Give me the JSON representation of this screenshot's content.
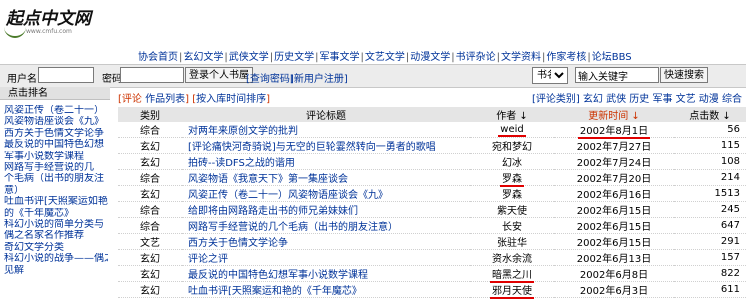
{
  "logo": {
    "text": "起点中文网",
    "url": "www.cmfu.com"
  },
  "nav": [
    "协会首页",
    "玄幻文学",
    "武侠文学",
    "历史文学",
    "军事文学",
    "文艺文学",
    "动漫文学",
    "书评杂论",
    "文学资料",
    "作家考核",
    "论坛BBS"
  ],
  "login": {
    "user_label": "用户名",
    "pass_label": "密码",
    "enter_button": "登录个人书屋",
    "query_pass": "[查询密码]",
    "register": "[新用户注册]",
    "search_select": "书名",
    "search_input": "输入关键字",
    "search_button": "快速搜索"
  },
  "sidebar": {
    "title": "点击排名",
    "items": [
      "风姿正传（卷二十一）",
      "风姿物语座谈会《九》",
      "西方关于色情文学论争",
      "最反说的中国特色幻想",
      "军事小说数学课程",
      "网路写手经营说的几",
      "个毛病（出书的朋友注",
      "意）",
      "吐血书评[天照案运如艳",
      "的《千年魔芯》",
      "科幻小说的简单分类与",
      "偶之名家名作推荐",
      "奇幻文学分类",
      "科幻小说的战争——偶之",
      "见解"
    ]
  },
  "main": {
    "review_label": "评论",
    "works_label": "作品列表",
    "sort_label": "按入库时间排序",
    "cat_links": "[评论类别] 玄幻 武侠 历史 军事 文艺 动漫 综合"
  },
  "table": {
    "headers": [
      "类别",
      "评论标题",
      "作者 ↓",
      "更新时间 ↓",
      "点击数 ↓"
    ],
    "rows": [
      {
        "cat": "综合",
        "title": "对两年来原创文学的批判",
        "author": "weid",
        "date": "2002年8月1日",
        "hits": "56",
        "mark_author": true,
        "mark_date": true
      },
      {
        "cat": "玄幻",
        "title": "[评论痛快河奇骑说]与无空的巨轮霎然转向一勇者的歌唱",
        "author": "宛和梦幻",
        "date": "2002年7月27日",
        "hits": "115"
      },
      {
        "cat": "玄幻",
        "title": "拍砖--读DFS之战的谐用",
        "author": "幻冰",
        "date": "2002年7月24日",
        "hits": "108"
      },
      {
        "cat": "综合",
        "title": "风姿物语《我意天下》第一集座谈会",
        "author": "罗森",
        "date": "2002年7月20日",
        "hits": "214",
        "mark_author": true
      },
      {
        "cat": "玄幻",
        "title": "风姿正传（卷二十一）风姿物语座谈会《九》",
        "author": "罗森",
        "date": "2002年6月16日",
        "hits": "1513"
      },
      {
        "cat": "综合",
        "title": "给即将由网路路走出书的师兄弟妹妹们",
        "author": "紫天使",
        "date": "2002年6月15日",
        "hits": "245"
      },
      {
        "cat": "综合",
        "title": "网路写手经营说的几个毛病（出书的朋友注意）",
        "author": "长安",
        "date": "2002年6月15日",
        "hits": "647"
      },
      {
        "cat": "文艺",
        "title": "西方关于色情文学论争",
        "author": "张驻华",
        "date": "2002年6月15日",
        "hits": "291"
      },
      {
        "cat": "玄幻",
        "title": "评论之评",
        "author": "资水余流",
        "date": "2002年6月13日",
        "hits": "157"
      },
      {
        "cat": "玄幻",
        "title": "最反说的中国特色幻想军事小说数学课程",
        "author": "暗黑之川",
        "date": "2002年6月8日",
        "hits": "822",
        "mark_author": true
      },
      {
        "cat": "玄幻",
        "title": "吐血书评[天照案运和艳的《千年魔芯》",
        "author": "邪月天使",
        "date": "2002年6月3日",
        "hits": "611",
        "mark_author": true
      }
    ]
  },
  "colors": {
    "link": "#003399",
    "header_bg": "#e5e5e5",
    "underline": "#e00000"
  }
}
